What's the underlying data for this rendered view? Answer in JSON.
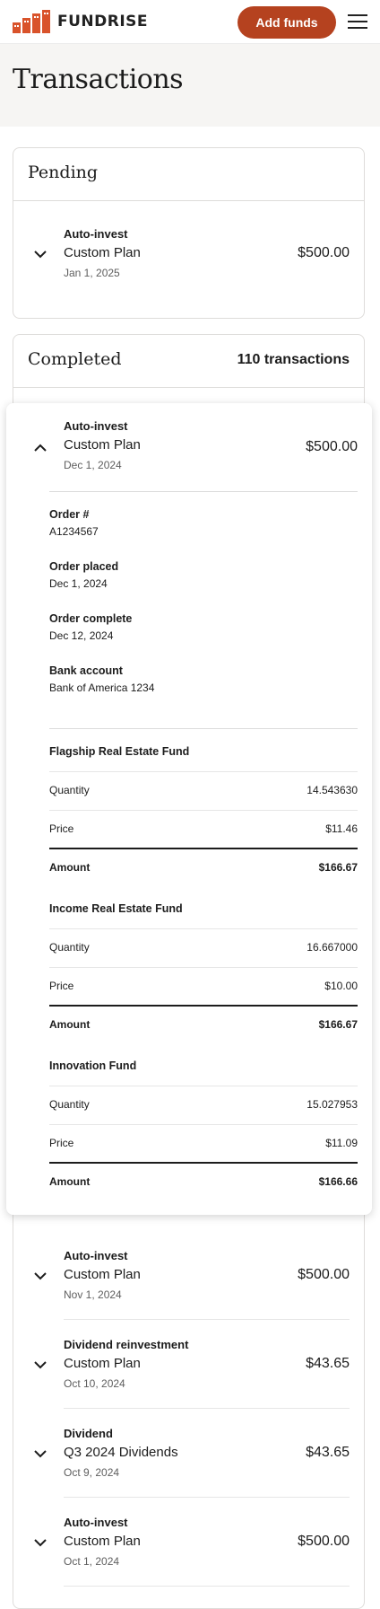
{
  "header": {
    "brand": "FUNDRISE",
    "add_funds_label": "Add funds",
    "brand_color": "#d9532b",
    "accent_button_color": "#b5421f"
  },
  "page": {
    "title": "Transactions"
  },
  "pending": {
    "heading": "Pending",
    "items": [
      {
        "type": "Auto-invest",
        "name": "Custom Plan",
        "date": "Jan 1, 2025",
        "amount": "$500.00"
      }
    ]
  },
  "completed": {
    "heading": "Completed",
    "count": "110 transactions",
    "expanded": {
      "type": "Auto-invest",
      "name": "Custom Plan",
      "date": "Dec 1, 2024",
      "amount": "$500.00",
      "details": [
        {
          "label": "Order #",
          "value": "A1234567"
        },
        {
          "label": "Order placed",
          "value": "Dec 1, 2024"
        },
        {
          "label": "Order complete",
          "value": "Dec 12, 2024"
        },
        {
          "label": "Bank account",
          "value": "Bank of America 1234"
        }
      ],
      "funds": [
        {
          "name": "Flagship Real Estate Fund",
          "quantity_label": "Quantity",
          "quantity": "14.543630",
          "price_label": "Price",
          "price": "$11.46",
          "amount_label": "Amount",
          "amount": "$166.67"
        },
        {
          "name": "Income Real Estate Fund",
          "quantity_label": "Quantity",
          "quantity": "16.667000",
          "price_label": "Price",
          "price": "$10.00",
          "amount_label": "Amount",
          "amount": "$166.67"
        },
        {
          "name": "Innovation Fund",
          "quantity_label": "Quantity",
          "quantity": "15.027953",
          "price_label": "Price",
          "price": "$11.09",
          "amount_label": "Amount",
          "amount": "$166.66"
        }
      ]
    },
    "items": [
      {
        "type": "Auto-invest",
        "name": "Custom Plan",
        "date": "Nov 1, 2024",
        "amount": "$500.00"
      },
      {
        "type": "Dividend reinvestment",
        "name": "Custom Plan",
        "date": "Oct 10, 2024",
        "amount": "$43.65"
      },
      {
        "type": "Dividend",
        "name": "Q3 2024 Dividends",
        "date": "Oct 9, 2024",
        "amount": "$43.65"
      },
      {
        "type": "Auto-invest",
        "name": "Custom Plan",
        "date": "Oct 1, 2024",
        "amount": "$500.00"
      }
    ]
  }
}
